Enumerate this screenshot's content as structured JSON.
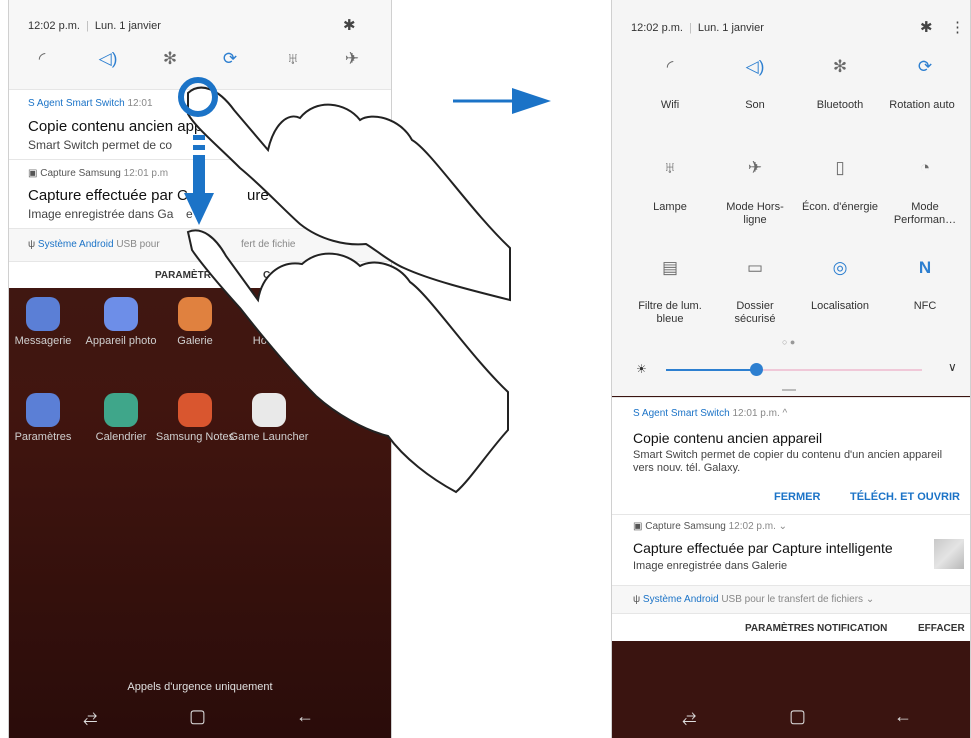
{
  "left": {
    "status": {
      "time": "12:02 p.m.",
      "date": "Lun. 1 janvier"
    },
    "quick_icons": [
      "wifi-icon",
      "sound-icon",
      "bluetooth-icon",
      "rotation-icon",
      "flashlight-icon",
      "airplane-icon"
    ],
    "notif1": {
      "app": "Agent Smart Switch",
      "time": "12:01",
      "title": "Copie contenu ancien app",
      "body": "Smart Switch permet de co"
    },
    "notif2": {
      "app": "Capture Samsung",
      "time": "12:01 p.m",
      "title": "Capture effectuée par C",
      "title2": "ure intellig",
      "body": "Image enregistrée dans Ga",
      "body2": "e"
    },
    "notif3": {
      "app": "Système Android",
      "detail": "USB pour",
      "detail2": "fert de fichie"
    },
    "footer": {
      "label": "PARAMÈTR",
      "label2": "CATI"
    },
    "apps_row1": [
      "Messagerie",
      "Appareil photo",
      "Galerie",
      "Horlog"
    ],
    "apps_row2": [
      "Paramètres",
      "Calendrier",
      "Samsung Notes",
      "Game Launcher"
    ],
    "emergency": "Appels d'urgence uniquement"
  },
  "right": {
    "status": {
      "time": "12:02 p.m.",
      "date": "Lun. 1 janvier"
    },
    "tiles": [
      {
        "label": "Wifi",
        "icon": "wifi-icon",
        "active": false
      },
      {
        "label": "Son",
        "icon": "sound-icon",
        "active": true
      },
      {
        "label": "Bluetooth",
        "icon": "bluetooth-icon",
        "active": false
      },
      {
        "label": "Rotation auto",
        "icon": "rotation-icon",
        "active": true
      },
      {
        "label": "Lampe",
        "icon": "flashlight-icon",
        "active": false
      },
      {
        "label": "Mode Hors-ligne",
        "icon": "airplane-icon",
        "active": false
      },
      {
        "label": "Écon. d'énergie",
        "icon": "battery-icon",
        "active": false
      },
      {
        "label": "Mode Performan…",
        "icon": "performance-icon",
        "active": false
      },
      {
        "label": "Filtre de lum. bleue",
        "icon": "blue-light-icon",
        "active": false
      },
      {
        "label": "Dossier sécurisé",
        "icon": "secure-folder-icon",
        "active": false
      },
      {
        "label": "Localisation",
        "icon": "location-icon",
        "active": true
      },
      {
        "label": "NFC",
        "icon": "nfc-icon",
        "active": true
      }
    ],
    "brightness": {
      "level": 0.35
    },
    "notif1": {
      "app": "Agent Smart Switch",
      "time": "12:01 p.m.",
      "title": "Copie contenu ancien appareil",
      "body": "Smart Switch permet de copier du contenu d'un ancien appareil vers nouv. tél. Galaxy.",
      "close": "FERMER",
      "download": "TÉLÉCH. ET OUVRIR"
    },
    "notif2": {
      "app": "Capture Samsung",
      "time": "12:02 p.m.",
      "title": "Capture effectuée par Capture intelligente",
      "body": "Image enregistrée dans Galerie"
    },
    "notif3": {
      "app": "Système Android",
      "detail": "USB pour le transfert de fichiers"
    },
    "footer": {
      "settings": "PARAMÈTRES NOTIFICATION",
      "clear": "EFFACER"
    }
  }
}
